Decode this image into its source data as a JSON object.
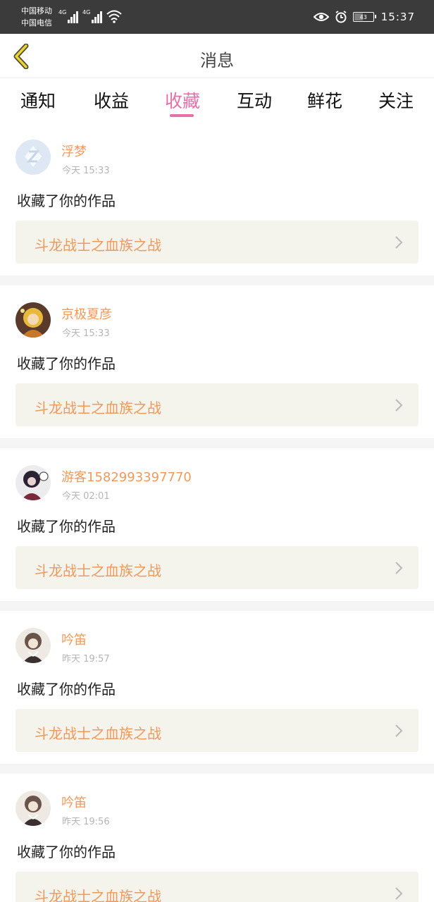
{
  "status_bar": {
    "carrier_1": "中国移动",
    "carrier_2": "中国电信",
    "network_1": "4G",
    "network_2": "4G",
    "battery": "43",
    "time": "15:37",
    "icons": [
      "eye-icon",
      "alarm-icon",
      "wifi-icon",
      "battery-icon"
    ]
  },
  "header": {
    "title": "消息",
    "back_icon": "chevron-left-icon"
  },
  "tabs": [
    {
      "label": "通知"
    },
    {
      "label": "收益"
    },
    {
      "label": "收藏",
      "active": true
    },
    {
      "label": "互动"
    },
    {
      "label": "鲜花"
    },
    {
      "label": "关注"
    }
  ],
  "messages": [
    {
      "user": "浮梦",
      "time": "今天 15:33",
      "action": "收藏了你的作品",
      "work": "斗龙战士之血族之战"
    },
    {
      "user": "京极夏彦",
      "time": "今天 15:33",
      "action": "收藏了你的作品",
      "work": "斗龙战士之血族之战"
    },
    {
      "user": "游客1582993397770",
      "time": "今天 02:01",
      "action": "收藏了你的作品",
      "work": "斗龙战士之血族之战"
    },
    {
      "user": "吟笛",
      "time": "昨天 19:57",
      "action": "收藏了你的作品",
      "work": "斗龙战士之血族之战"
    },
    {
      "user": "吟笛",
      "time": "昨天 19:56",
      "action": "收藏了你的作品",
      "work": "斗龙战士之血族之战"
    }
  ],
  "colors": {
    "accent": "#e76fa8",
    "username": "#ef9a5a",
    "work_bg": "#f4f3ec",
    "status_bar": "#3b3b3b"
  }
}
